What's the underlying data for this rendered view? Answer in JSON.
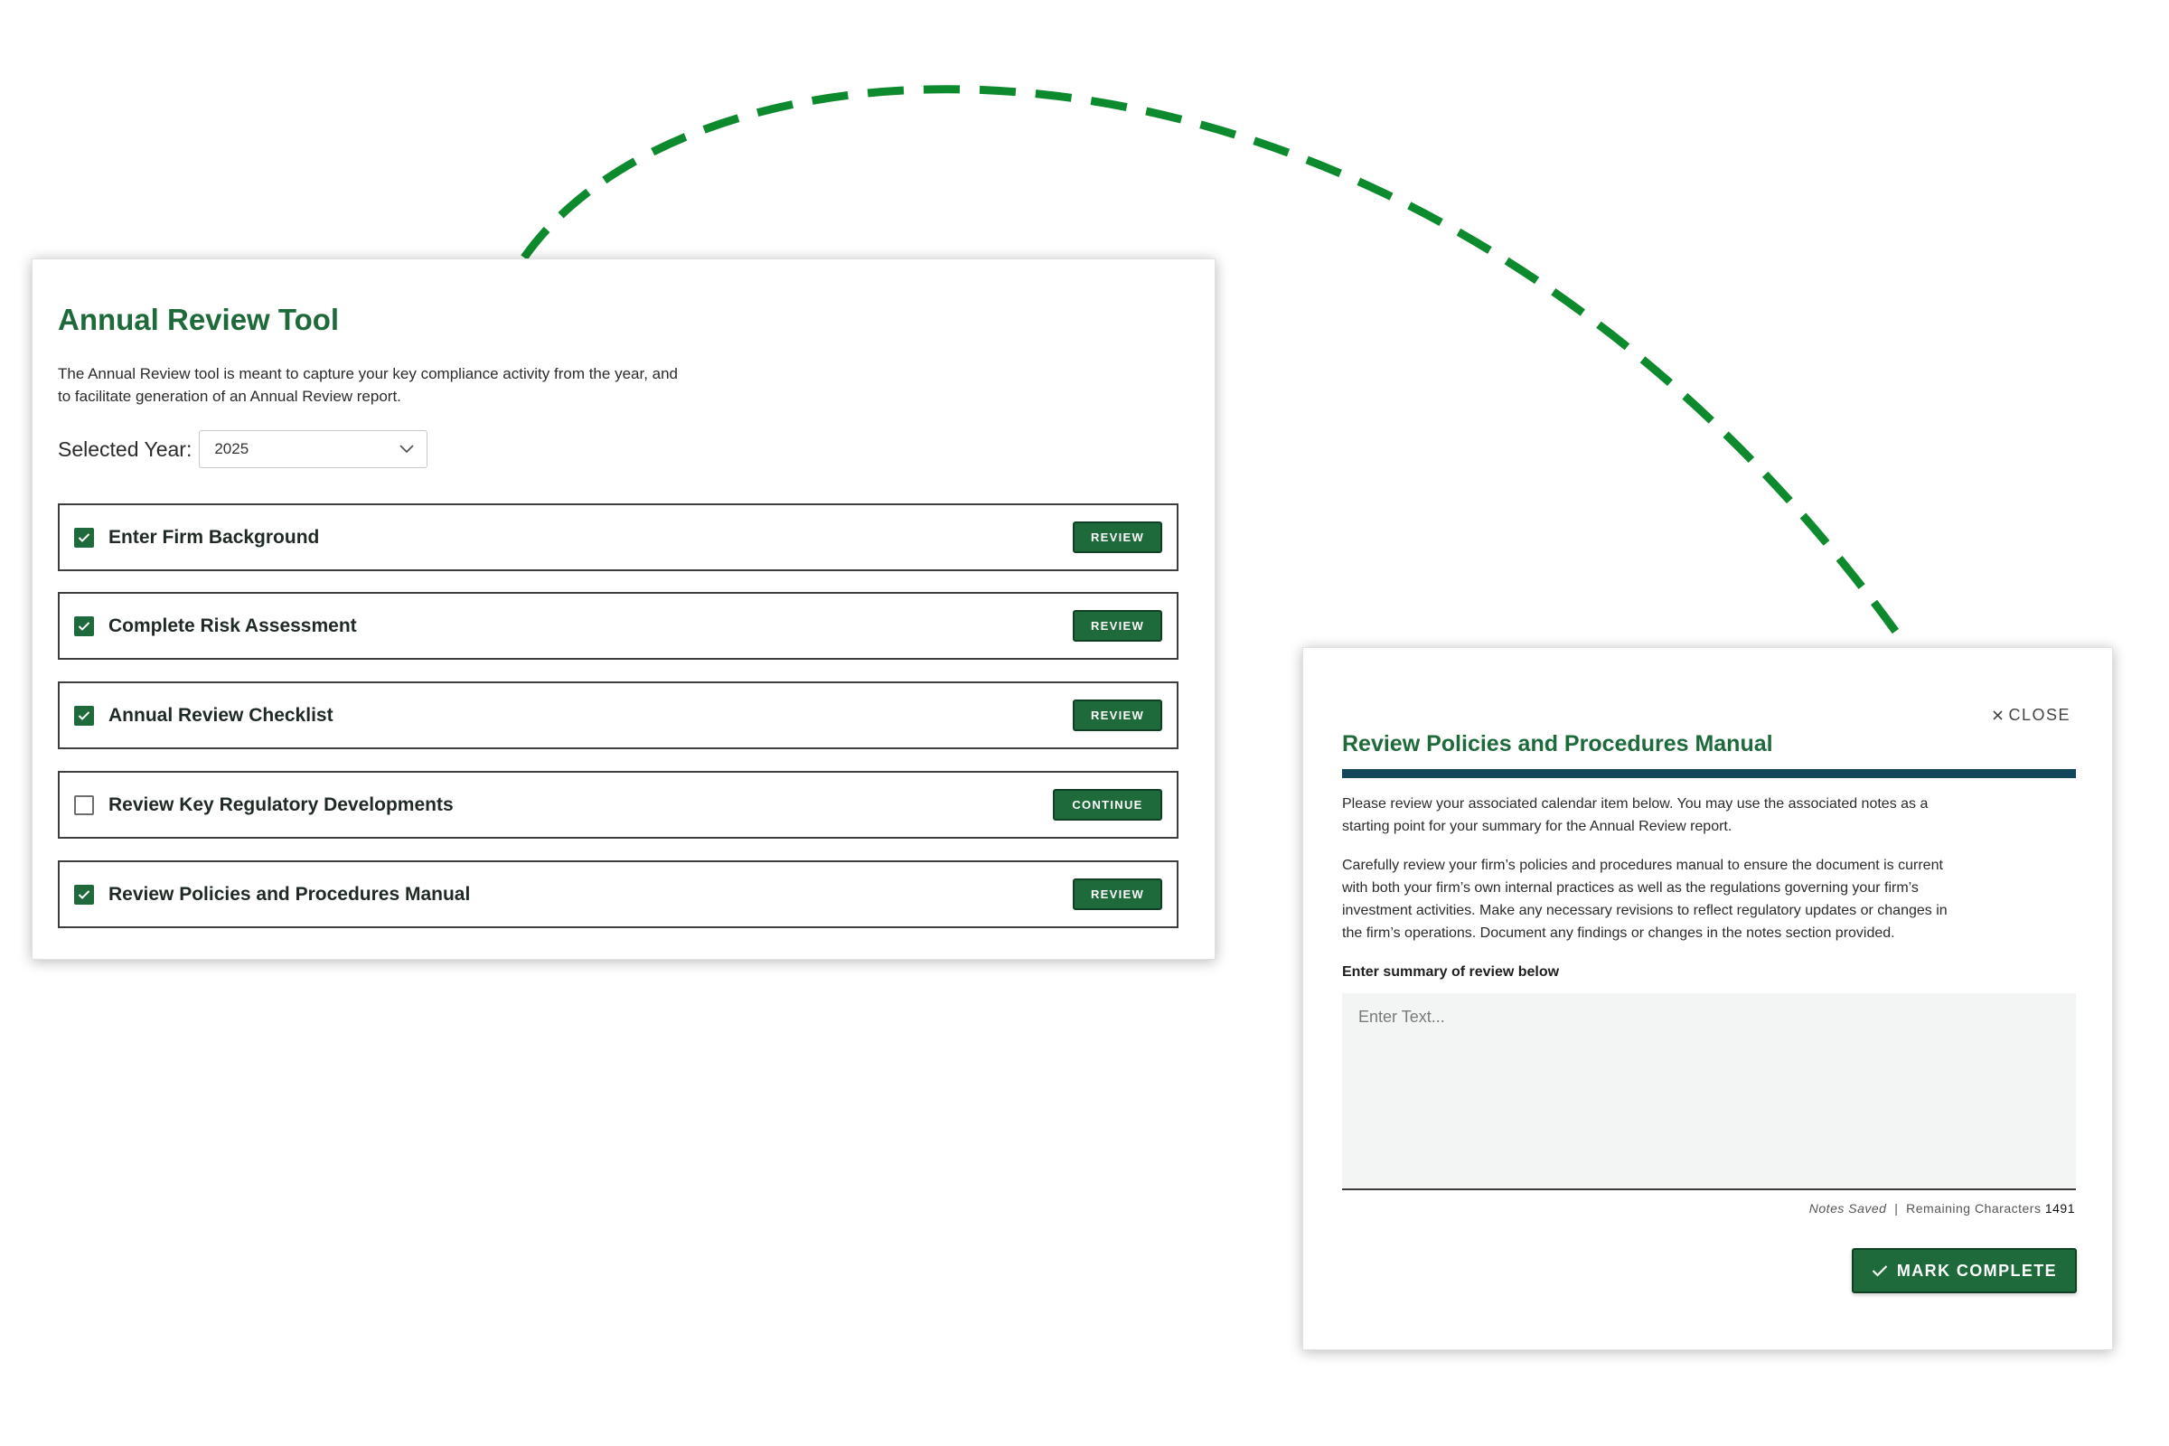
{
  "colors": {
    "brand_green": "#1e6a3b",
    "connector_green": "#0d8a2e",
    "rule_navy": "#12445c"
  },
  "main": {
    "title": "Annual Review Tool",
    "intro_line1": "The Annual Review tool is meant to capture your key compliance activity from the year, and",
    "intro_line2": "to facilitate generation of an Annual Review report.",
    "year_label": "Selected Year:",
    "year_value": "2025",
    "tasks": [
      {
        "label": "Enter Firm Background",
        "checked": true,
        "button": "REVIEW"
      },
      {
        "label": "Complete Risk Assessment",
        "checked": true,
        "button": "REVIEW"
      },
      {
        "label": "Annual Review Checklist",
        "checked": true,
        "button": "REVIEW"
      },
      {
        "label": "Review Key Regulatory Developments",
        "checked": false,
        "button": "CONTINUE"
      },
      {
        "label": "Review Policies and Procedures Manual",
        "checked": true,
        "button": "REVIEW"
      }
    ]
  },
  "dialog": {
    "close_label": "CLOSE",
    "title": "Review Policies and Procedures Manual",
    "paragraph1_line1": "Please review your associated calendar item below. You may use the associated notes as a",
    "paragraph1_line2": "starting point for your summary for the Annual Review report.",
    "paragraph2_line1": "Carefully review your firm’s policies and procedures manual to ensure the document is current",
    "paragraph2_line2": "with both your firm’s own internal practices as well as the regulations governing your firm’s",
    "paragraph2_line3": "investment activities. Make any necessary revisions to reflect regulatory updates or changes in",
    "paragraph2_line4": "the firm’s operations. Document any findings or changes in the notes section provided.",
    "field_label": "Enter summary of review below",
    "field_placeholder": "Enter Text...",
    "field_value": "",
    "status_saved": "Notes Saved",
    "status_separator": "|",
    "status_remaining_label": "Remaining Characters",
    "status_remaining_count": "1491",
    "mark_complete_label": "MARK COMPLETE"
  }
}
